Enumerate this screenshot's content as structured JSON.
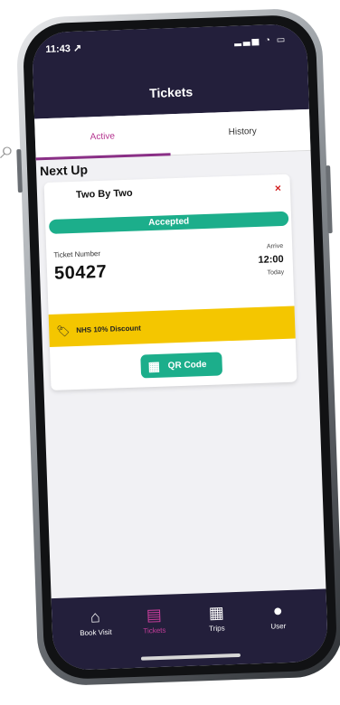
{
  "status": {
    "time": "11:43 ↗",
    "icons": ""
  },
  "header": {
    "title": "Tickets"
  },
  "tabs": {
    "active": "Active",
    "history": "History"
  },
  "section": {
    "title": "Next Up"
  },
  "ticket": {
    "venue_logo_text": "",
    "venue_name": "Two By Two",
    "remove_icon": "×",
    "status": "Accepted",
    "ticket_number_label": "Ticket Number",
    "ticket_number": "50427",
    "arrive_label": "Arrive",
    "arrive_time": "12:00",
    "arrive_day": "Today",
    "discount_label": "NHS 10% Discount",
    "qr_button_label": "QR Code"
  },
  "nav": {
    "items": [
      {
        "label": "Book Visit",
        "icon": "store-icon"
      },
      {
        "label": "Tickets",
        "icon": "ticket-icon"
      },
      {
        "label": "Trips",
        "icon": "calendar-icon"
      },
      {
        "label": "User",
        "icon": "user-icon"
      }
    ]
  },
  "colors": {
    "header": "#231f3b",
    "active_tab": "#b4328e",
    "accepted": "#1cae8b",
    "discount": "#f4c600",
    "remove": "#d11c1c"
  }
}
